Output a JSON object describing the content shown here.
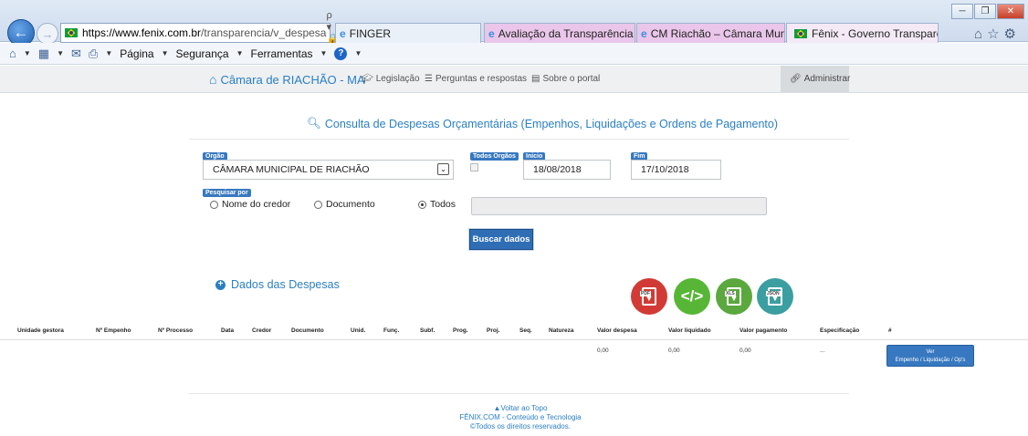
{
  "browser": {
    "address_host": "https://www.fenix.com.br",
    "address_path": "/transparencia/v_despesa",
    "address_tools": "ρ ▾ 🔒 C",
    "tabs": [
      {
        "label": "FINGER"
      },
      {
        "label": "Avaliação da Transparência do..."
      },
      {
        "label": "CM Riachão – Câmara Munici..."
      },
      {
        "label": "Fênix - Governo Transparen..."
      }
    ],
    "tab_close": "×",
    "command_bar": {
      "pagina": "Página",
      "seguranca": "Segurança",
      "ferramentas": "Ferramentas"
    }
  },
  "site": {
    "brand": "Câmara de RIACHÃO - MA",
    "nav": {
      "legislacao": "Legislação",
      "perguntas": "Perguntas e respostas",
      "sobre": "Sobre o portal",
      "administrar": "Administrar"
    }
  },
  "page": {
    "title": "Consulta de Despesas Orçamentárias (Empenhos, Liquidações e Ordens de Pagamento)"
  },
  "form": {
    "orgao_label": "Orgão",
    "orgao_value": "CÂMARA MUNICIPAL DE RIACHÃO",
    "todos_orgaos_label": "Todos Orgãos",
    "inicio_label": "Inicio",
    "inicio_value": "18/08/2018",
    "fim_label": "Fim",
    "fim_value": "17/10/2018",
    "pesquisar_label": "Pesquisar por",
    "radio_credor": "Nome do credor",
    "radio_documento": "Documento",
    "radio_todos": "Todos",
    "search_value": "",
    "submit": "Buscar dados"
  },
  "results": {
    "section_title": "Dados das Despesas",
    "export": {
      "pdf": "PDF",
      "xml": "</>",
      "xls": "XLS",
      "json": "JSON"
    },
    "columns": [
      "Unidade gestora",
      "Nº Empenho",
      "Nº Processo",
      "Data",
      "Credor",
      "Documento",
      "Unid.",
      "Funç.",
      "Subf.",
      "Prog.",
      "Proj.",
      "Seq.",
      "Natureza",
      "Valor despesa",
      "Valor liquidado",
      "Valor pagamento",
      "Especificação",
      "#"
    ],
    "row": {
      "valor_despesa": "0,00",
      "valor_liquidado": "0,00",
      "valor_pagamento": "0,00",
      "especificacao": "...",
      "ver_line1": "Ver",
      "ver_line2": "Empenho / Liquidação / Op's"
    }
  },
  "footer": {
    "top": "Voltar ao Topo",
    "company": "FÊNIX.COM - Conteúdo e Tecnologia",
    "rights": "©Todos os direitos reservados."
  }
}
